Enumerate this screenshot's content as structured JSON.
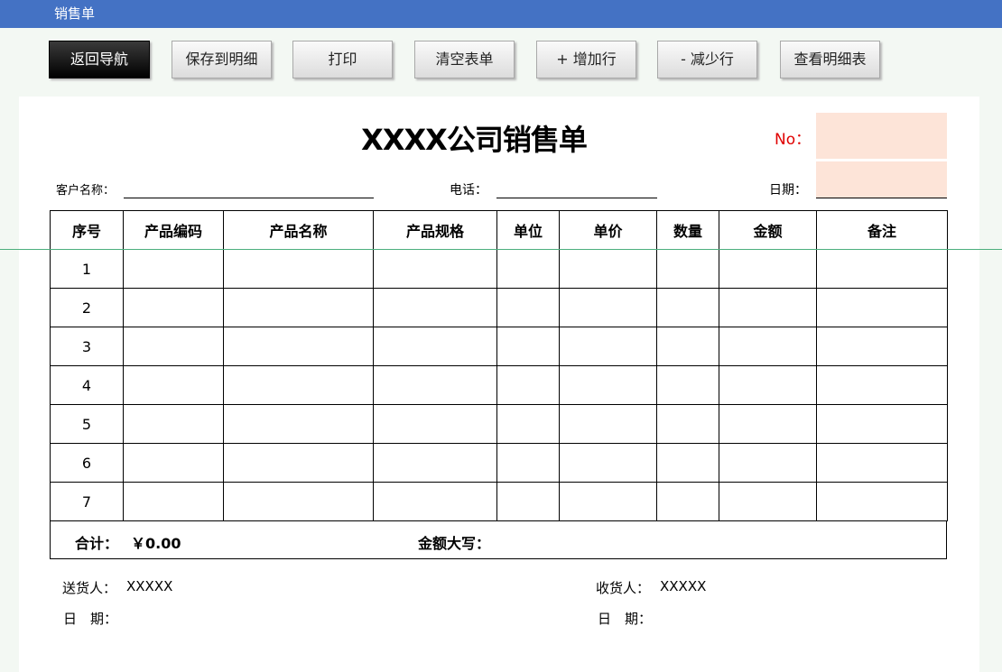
{
  "window": {
    "title": "销售单"
  },
  "toolbar": {
    "buttons": [
      {
        "label": "返回导航"
      },
      {
        "label": "保存到明细"
      },
      {
        "label": "打印"
      },
      {
        "label": "清空表单"
      },
      {
        "label": "+ 增加行"
      },
      {
        "label": "- 减少行"
      },
      {
        "label": "查看明细表"
      }
    ]
  },
  "form": {
    "title": "XXXX公司销售单",
    "no_label": "No：",
    "no_value": "",
    "date_value": "",
    "customer_label": "客户名称：",
    "customer_value": "",
    "phone_label": "电话：",
    "phone_value": "",
    "date_label": "日期：",
    "columns": [
      "序号",
      "产品编码",
      "产品名称",
      "产品规格",
      "单位",
      "单价",
      "数量",
      "金额",
      "备注"
    ],
    "rows": [
      {
        "no": "1"
      },
      {
        "no": "2"
      },
      {
        "no": "3"
      },
      {
        "no": "4"
      },
      {
        "no": "5"
      },
      {
        "no": "6"
      },
      {
        "no": "7"
      }
    ],
    "total_label": "合计：",
    "total_value": "￥0.00",
    "amount_words_label": "金额大写：",
    "deliverer_label": "送货人：",
    "deliverer_value": "XXXXX",
    "receiver_label": "收货人：",
    "receiver_value": "XXXXX",
    "sign_date_label": "日　期：",
    "recv_date_label": "日　期："
  },
  "colors": {
    "topbar": "#4472c4",
    "peach_field": "#fde4d8",
    "no_label": "#e00000"
  }
}
